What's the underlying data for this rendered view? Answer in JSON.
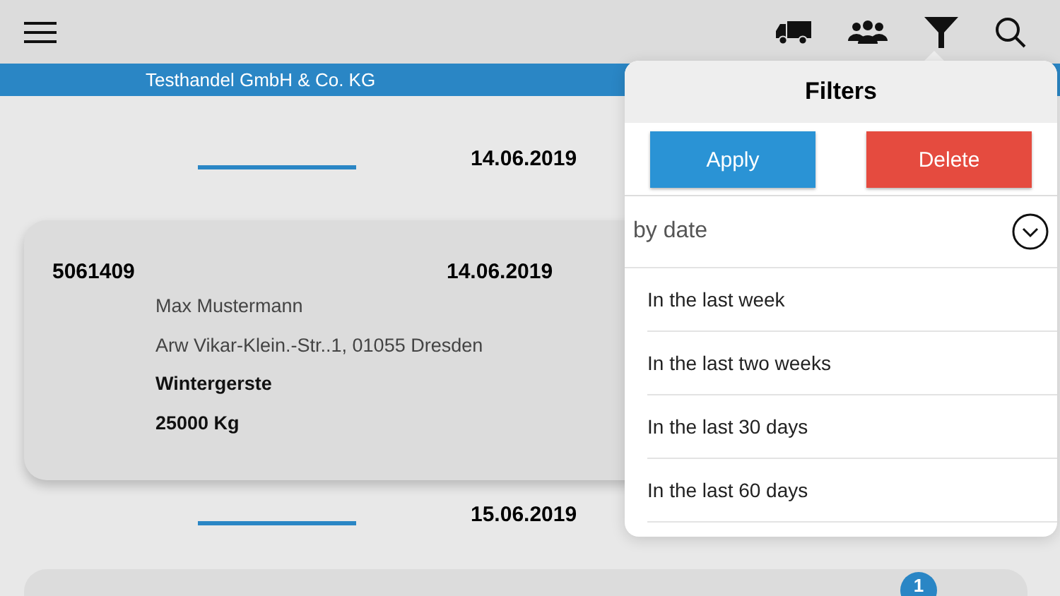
{
  "company": "Testhandel GmbH & Co. KG",
  "groups": [
    {
      "date": "14.06.2019",
      "orders": [
        {
          "number": "5061409",
          "date": "14.06.2019",
          "name": "Max Mustermann",
          "address": "Arw Vikar-Klein.-Str..1, 01055 Dresden",
          "product": "Wintergerste",
          "quantity": "25000 Kg"
        }
      ]
    },
    {
      "date": "15.06.2019",
      "orders": [
        {
          "badge": "1"
        }
      ]
    }
  ],
  "filters": {
    "title": "Filters",
    "apply": "Apply",
    "delete": "Delete",
    "dropdown": "by date",
    "options": [
      "In the last week",
      "In the last two weeks",
      "In the last 30 days",
      "In the last 60 days"
    ]
  }
}
